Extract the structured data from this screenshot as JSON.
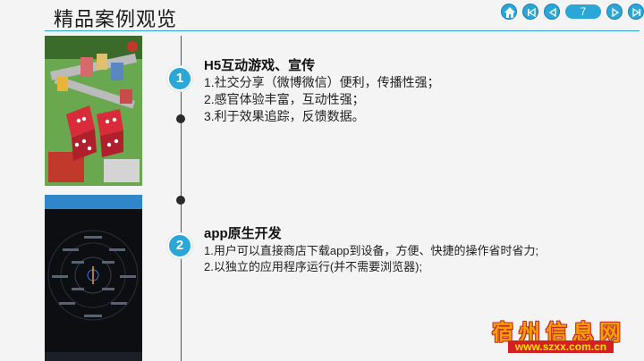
{
  "page": {
    "title": "精品案例观览",
    "page_number": "7"
  },
  "nav": {
    "icons": [
      "home-icon",
      "first-page-icon",
      "prev-page-icon",
      "next-page-icon",
      "last-page-icon"
    ],
    "color": "#2aa7d6"
  },
  "sections": [
    {
      "number": "1",
      "title": "H5互动游戏、宣传",
      "lines": [
        "1.社交分享（微博微信）便利，传播性强；",
        "2.感官体验丰富，互动性强；",
        "3.利于效果追踪，反馈数据。"
      ]
    },
    {
      "number": "2",
      "title": "app原生开发",
      "lines": [
        "1.用户可以直接商店下载app到设备，方便、快捷的操作省时省力;",
        "2.以独立的应用程序运行(并不需要浏览器);"
      ]
    }
  ],
  "watermark": {
    "name": "宿州信息网",
    "url": "www.szxx.com.cn"
  }
}
